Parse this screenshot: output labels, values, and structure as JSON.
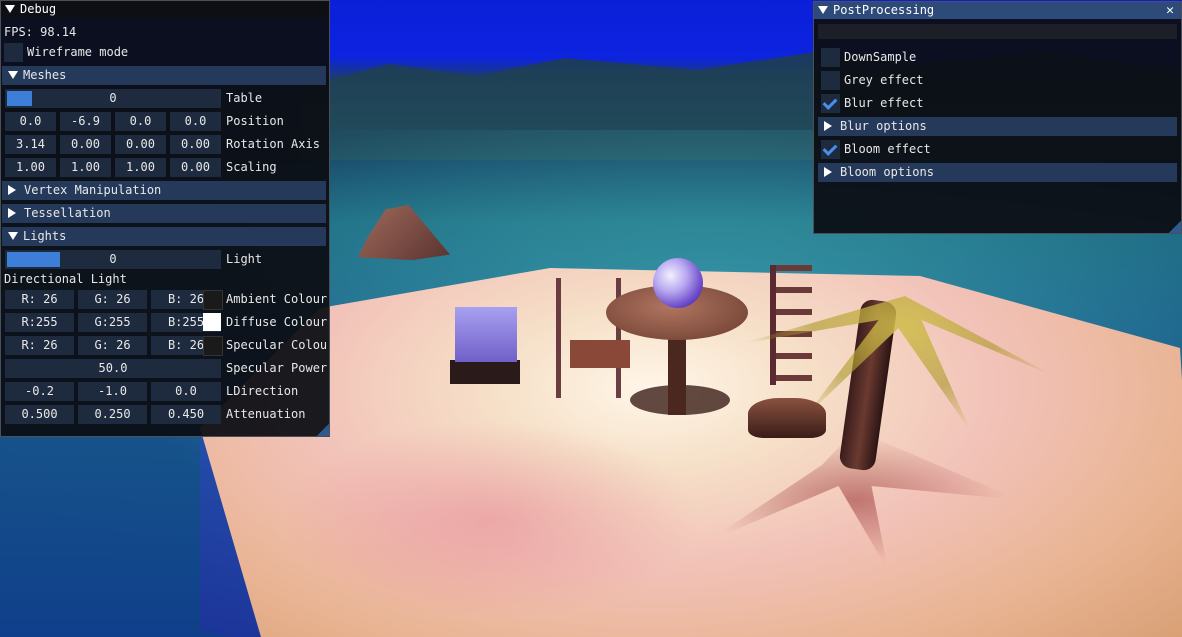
{
  "debug_window": {
    "title": "Debug",
    "fps": "FPS: 98.14",
    "wireframe_label": "Wireframe mode",
    "meshes_header": "Meshes",
    "table_value": "0",
    "table_label": "Table",
    "table_fill_fraction": 0.12,
    "position": [
      "0.0",
      "-6.9",
      "0.0",
      "0.0"
    ],
    "position_label": "Position",
    "rotation": [
      "3.14",
      "0.00",
      "0.00",
      "0.00"
    ],
    "rotation_label": "Rotation Axis",
    "scaling": [
      "1.00",
      "1.00",
      "1.00",
      "0.00"
    ],
    "scaling_label": "Scaling",
    "vertex_header": "Vertex Manipulation",
    "tess_header": "Tessellation",
    "lights_header": "Lights",
    "light_value": "0",
    "light_label": "Light",
    "light_fill_fraction": 0.25,
    "directional_label": "Directional Light",
    "ambient": [
      "R: 26",
      "G: 26",
      "B: 26"
    ],
    "ambient_label": "Ambient Colour",
    "ambient_color": "#1a1a1a",
    "diffuse": [
      "R:255",
      "G:255",
      "B:255"
    ],
    "diffuse_label": "Diffuse Colour",
    "diffuse_color": "#ffffff",
    "specular": [
      "R: 26",
      "G: 26",
      "B: 26"
    ],
    "specular_label": "Specular Colour",
    "specular_color": "#1a1a1a",
    "specular_power": "50.0",
    "specular_power_label": "Specular Power",
    "ldirection": [
      "-0.2",
      "-1.0",
      "0.0"
    ],
    "ldirection_label": "LDirection",
    "attenuation": [
      "0.500",
      "0.250",
      "0.450"
    ],
    "attenuation_label": "Attenuation"
  },
  "pp_window": {
    "title": "PostProcessing",
    "downsample_label": "DownSample",
    "grey_label": "Grey effect",
    "blur_label": "Blur effect",
    "blur_options_header": "Blur options",
    "bloom_label": "Bloom effect",
    "bloom_options_header": "Bloom options",
    "downsample_checked": false,
    "grey_checked": false,
    "blur_checked": true,
    "bloom_checked": true
  },
  "theme": {
    "frame_bg": "#1e2a3e",
    "header_bg": "#253a5a",
    "accent": "#3d7fd8",
    "check": "#4a90e8"
  }
}
